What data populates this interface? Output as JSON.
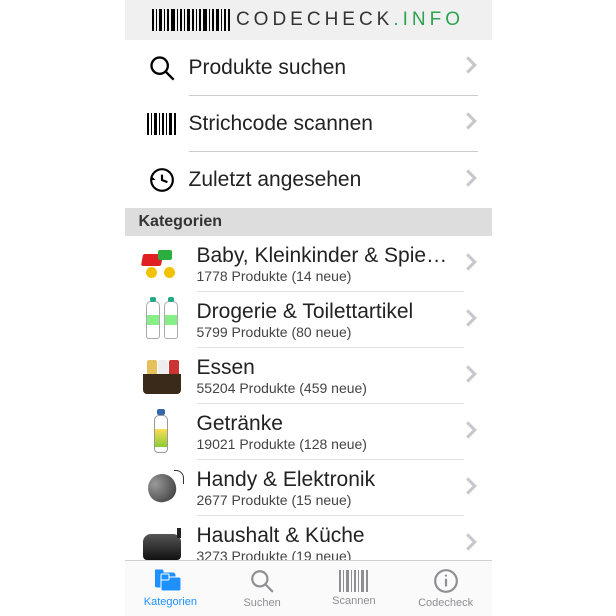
{
  "logo": {
    "word": "CODECHECK",
    "dot": ".",
    "suffix": "INFO"
  },
  "actions": [
    {
      "id": "search",
      "label": "Produkte suchen",
      "icon": "search-icon"
    },
    {
      "id": "scan",
      "label": "Strichcode scannen",
      "icon": "barcode-icon"
    },
    {
      "id": "recent",
      "label": "Zuletzt angesehen",
      "icon": "history-icon"
    }
  ],
  "section_header": "Kategorien",
  "categories": [
    {
      "id": "baby",
      "title": "Baby, Kleinkinder & Spie…",
      "sub": "1778 Produkte (14 neue)"
    },
    {
      "id": "drogerie",
      "title": "Drogerie & Toilettartikel",
      "sub": "5799 Produkte (80 neue)"
    },
    {
      "id": "essen",
      "title": "Essen",
      "sub": "55204 Produkte (459 neue)"
    },
    {
      "id": "getraenke",
      "title": "Getränke",
      "sub": "19021 Produkte (128 neue)"
    },
    {
      "id": "handy",
      "title": "Handy & Elektronik",
      "sub": "2677 Produkte (15 neue)"
    },
    {
      "id": "haushalt",
      "title": "Haushalt & Küche",
      "sub": "3273 Produkte (19 neue)"
    }
  ],
  "tabs": [
    {
      "id": "kategorien",
      "label": "Kategorien",
      "icon": "folder-icon",
      "active": true
    },
    {
      "id": "suchen",
      "label": "Suchen",
      "icon": "search-icon",
      "active": false
    },
    {
      "id": "scannen",
      "label": "Scannen",
      "icon": "barcode-icon",
      "active": false
    },
    {
      "id": "codecheck",
      "label": "Codecheck",
      "icon": "info-icon",
      "active": false
    }
  ],
  "colors": {
    "accent": "#1e90ff",
    "green": "#2ea44f"
  }
}
